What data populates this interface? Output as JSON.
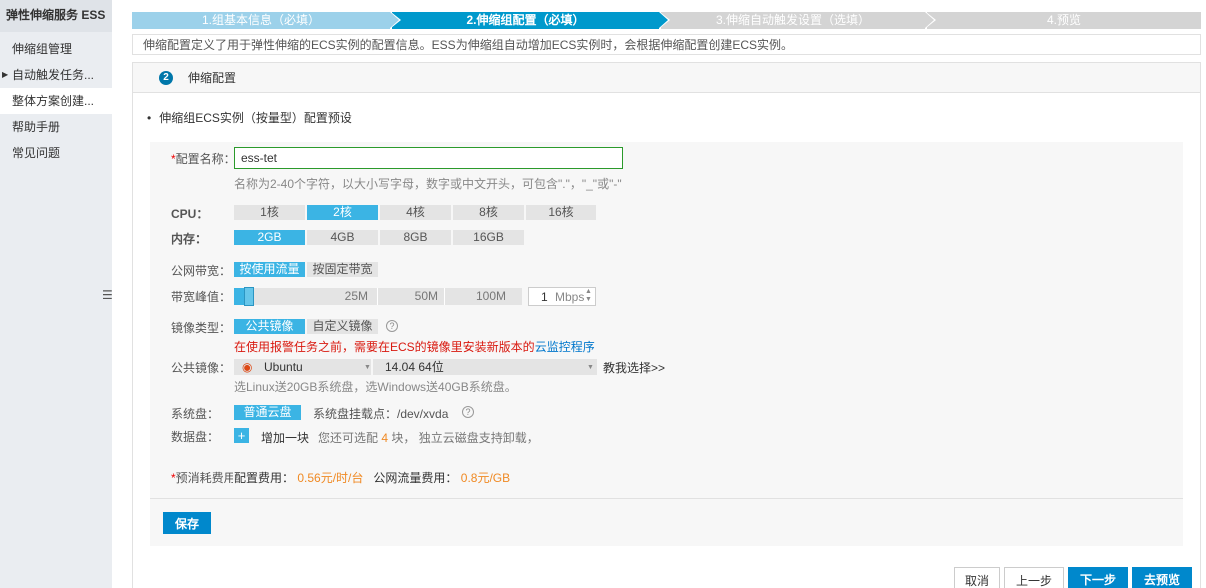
{
  "sidebar": {
    "brand": "弹性伸缩服务 ESS",
    "items": [
      {
        "label": "伸缩组管理"
      },
      {
        "label": "自动触发任务..."
      },
      {
        "label": "整体方案创建..."
      },
      {
        "label": "帮助手册"
      },
      {
        "label": "常见问题"
      }
    ],
    "toggle_icon": "☰"
  },
  "steps": [
    {
      "label": "1.组基本信息（必填）",
      "state": "done"
    },
    {
      "label": "2.伸缩组配置（必填）",
      "state": "current"
    },
    {
      "label": "3.伸缩自动触发设置（选填）",
      "state": "todo"
    },
    {
      "label": "4.预览",
      "state": "todo"
    }
  ],
  "description": "伸缩配置定义了用于弹性伸缩的ECS实例的配置信息。ESS为伸缩组自动增加ECS实例时，会根据伸缩配置创建ECS实例。",
  "panel": {
    "step_number": "2",
    "title": "伸缩配置"
  },
  "section_title": "伸缩组ECS实例（按量型）配置预设",
  "config_name": {
    "required_mark": "*",
    "label": "配置名称：",
    "value": "ess-tet",
    "hint": "名称为2-40个字符，以大小写字母，数字或中文开头，可包含\".\"，\"_\"或\"-\""
  },
  "cpu": {
    "label": "CPU：",
    "options": [
      "1核",
      "2核",
      "4核",
      "8核",
      "16核"
    ],
    "selected": 1
  },
  "memory": {
    "label": "内存：",
    "options": [
      "2GB",
      "4GB",
      "8GB",
      "16GB"
    ],
    "selected": 0
  },
  "bandwidth_type": {
    "label": "公网带宽：",
    "options": [
      "按使用流量",
      "按固定带宽"
    ],
    "selected": 0
  },
  "bandwidth_peak": {
    "label": "带宽峰值：",
    "ticks": [
      "25M",
      "50M",
      "100M"
    ],
    "value": "1",
    "unit": "Mbps"
  },
  "image_type": {
    "label": "镜像类型：",
    "options": [
      "公共镜像",
      "自定义镜像"
    ],
    "selected": 0,
    "help_icon": "?",
    "warning_prefix": "在使用报警任务之前，需要在ECS的镜像里安装新版本的",
    "warning_link": "云监控程序"
  },
  "public_image": {
    "label": "公共镜像：",
    "os": "Ubuntu",
    "version": "14.04 64位",
    "teach_link": "教我选择>>",
    "hint": "选Linux送20GB系统盘，选Windows送40GB系统盘。"
  },
  "system_disk": {
    "label": "系统盘：",
    "option": "普通云盘",
    "mount_text": "系统盘挂载点：/dev/xvda",
    "help_icon": "?"
  },
  "data_disk": {
    "label": "数据盘：",
    "add_icon": "+",
    "add_label": "增加一块",
    "remain_prefix": "您还可选配",
    "remain_count": "4",
    "remain_suffix": "块， 独立云磁盘支持卸载，"
  },
  "cost": {
    "required_mark": "*",
    "label": "预消耗费用",
    "config_label": "配置费用：",
    "config_price": "0.56元/时/台",
    "traffic_label": "公网流量费用：",
    "traffic_price": "0.8元/GB"
  },
  "buttons": {
    "save": "保存",
    "cancel": "取消",
    "prev": "上一步",
    "next": "下一步",
    "preview": "去预览"
  },
  "colors": {
    "accent": "#0099cc",
    "selected": "#3bb4e4",
    "price": "#f08a24",
    "warning": "#d9190f"
  }
}
